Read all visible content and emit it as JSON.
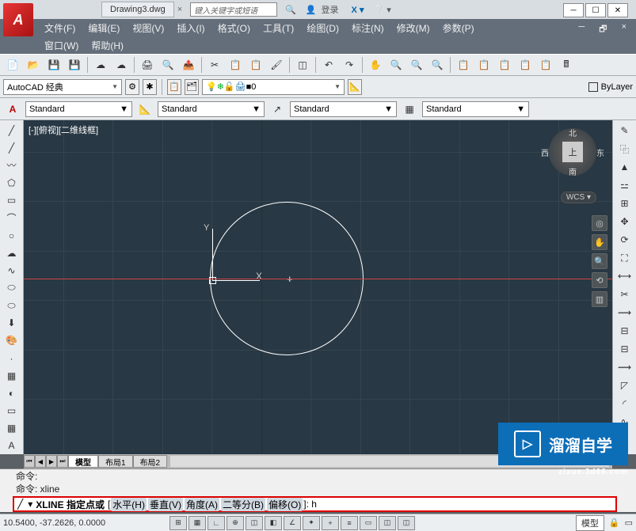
{
  "app": {
    "title": "AutoCAD",
    "file": "Drawing3.dwg"
  },
  "search": {
    "placeholder": "键入关键字或短语"
  },
  "login": {
    "text": "登录"
  },
  "menu": {
    "file": "文件(F)",
    "edit": "编辑(E)",
    "view": "视图(V)",
    "insert": "插入(I)",
    "format": "格式(O)",
    "tools": "工具(T)",
    "draw": "绘图(D)",
    "annotate": "标注(N)",
    "modify": "修改(M)",
    "params": "参数(P)",
    "window": "窗口(W)",
    "help": "帮助(H)"
  },
  "workspace": {
    "name": "AutoCAD 经典"
  },
  "layer": {
    "current": "0"
  },
  "bylayer": {
    "label": "ByLayer"
  },
  "styles": {
    "text": "Standard",
    "dim": "Standard",
    "mleader": "Standard",
    "table": "Standard"
  },
  "view": {
    "label": "[-][俯视][二维线框]"
  },
  "viewcube": {
    "top": "上",
    "n": "北",
    "s": "南",
    "e": "东",
    "w": "西",
    "wcs": "WCS"
  },
  "ucs": {
    "x": "X",
    "y": "Y"
  },
  "tabs": {
    "model": "模型",
    "layout1": "布局1",
    "layout2": "布局2"
  },
  "cmd": {
    "empty": "命令:",
    "last": "命令:  xline",
    "prompt_label": "XLINE 指定点或",
    "opt_h": "水平(H)",
    "opt_v": "垂直(V)",
    "opt_a": "角度(A)",
    "opt_b": "二等分(B)",
    "opt_o": "偏移(O)",
    "suffix": "]:  h"
  },
  "status": {
    "coords": "10.5400, -37.2626, 0.0000",
    "space": "模型"
  },
  "watermark": {
    "text": "溜溜自学",
    "url": "zixue.3d66.com"
  }
}
